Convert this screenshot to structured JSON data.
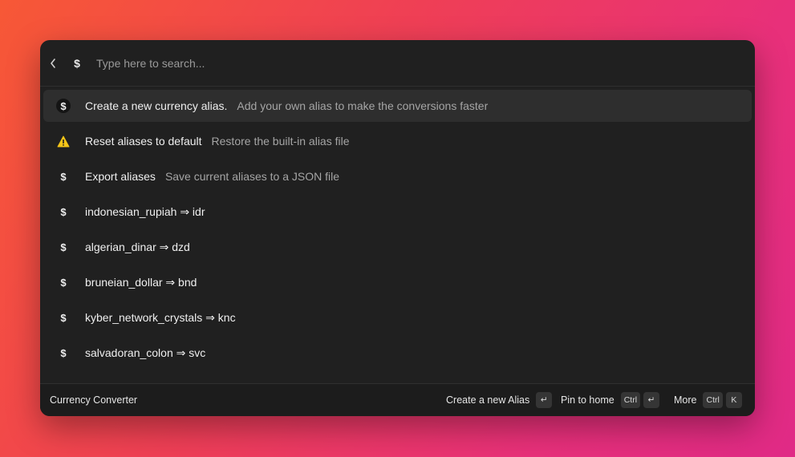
{
  "search": {
    "placeholder": "Type here to search...",
    "extension_icon": "dollar-icon",
    "back_icon": "chevron-left-icon"
  },
  "items": [
    {
      "icon": "dollar-badge-icon",
      "title": "Create a new currency alias.",
      "subtitle": "Add your own alias to make the conversions faster",
      "selected": true
    },
    {
      "icon": "warning-icon",
      "title": "Reset aliases to default",
      "subtitle": "Restore the built-in alias file"
    },
    {
      "icon": "dollar-icon",
      "title": "Export aliases",
      "subtitle": "Save current aliases to a JSON file"
    },
    {
      "icon": "dollar-icon",
      "title": "indonesian_rupiah ⇒ idr",
      "subtitle": ""
    },
    {
      "icon": "dollar-icon",
      "title": "algerian_dinar ⇒ dzd",
      "subtitle": ""
    },
    {
      "icon": "dollar-icon",
      "title": "bruneian_dollar ⇒ bnd",
      "subtitle": ""
    },
    {
      "icon": "dollar-icon",
      "title": "kyber_network_crystals ⇒ knc",
      "subtitle": ""
    },
    {
      "icon": "dollar-icon",
      "title": "salvadoran_colon ⇒ svc",
      "subtitle": ""
    }
  ],
  "footer": {
    "title": "Currency Converter",
    "primary_action": {
      "label": "Create a new Alias",
      "keys": [
        "↵"
      ]
    },
    "secondary_action": {
      "label": "Pin to home",
      "keys": [
        "Ctrl",
        "↵"
      ]
    },
    "more_action": {
      "label": "More",
      "keys": [
        "Ctrl",
        "K"
      ]
    }
  },
  "colors": {
    "window_bg": "#202020",
    "selected_bg": "#2e2e2e",
    "warning": "#f5c518"
  }
}
